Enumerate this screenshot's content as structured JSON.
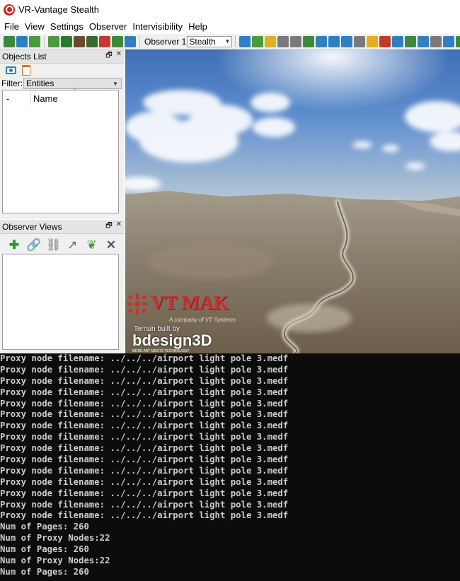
{
  "window": {
    "title": "VR-Vantage Stealth"
  },
  "menu": [
    "File",
    "View",
    "Settings",
    "Observer",
    "Intervisibility",
    "Help"
  ],
  "toolbar": {
    "observer_label": "Observer 1",
    "observer_mode": "Stealth",
    "icon_colors": [
      "#3a8a3a",
      "#2f7fc1",
      "#4b9a3b",
      "#6b4a2a",
      "#c23a2e",
      "#e0b020",
      "#7a7a7a"
    ]
  },
  "objects_panel": {
    "title": "Objects List",
    "filter_label": "Filter:",
    "filter_value": "Entities",
    "columns": [
      "-",
      "Name"
    ],
    "rows": []
  },
  "views_panel": {
    "title": "Observer Views",
    "rows": []
  },
  "viewport": {
    "logo_name": "VT MAK",
    "logo_subtitle": "A company of VT Systems",
    "terrain_credit": "Terrain built by",
    "terrain_brand": "bdesign3D",
    "terrain_tagline": "MERE ART MEETS TECHNOLOGY"
  },
  "console": {
    "lines": [
      "Proxy node filename: ../../../airport light pole 3.medf",
      "Proxy node filename: ../../../airport light pole 3.medf",
      "Proxy node filename: ../../../airport light pole 3.medf",
      "Proxy node filename: ../../../airport light pole 3.medf",
      "Proxy node filename: ../../../airport light pole 3.medf",
      "Proxy node filename: ../../../airport light pole 3.medf",
      "Proxy node filename: ../../../airport light pole 3.medf",
      "Proxy node filename: ../../../airport light pole 3.medf",
      "Proxy node filename: ../../../airport light pole 3.medf",
      "Proxy node filename: ../../../airport light pole 3.medf",
      "Proxy node filename: ../../../airport light pole 3.medf",
      "Proxy node filename: ../../../airport light pole 3.medf",
      "Proxy node filename: ../../../airport light pole 3.medf",
      "Proxy node filename: ../../../airport light pole 3.medf",
      "Proxy node filename: ../../../airport light pole 3.medf",
      "Num of Pages: 260",
      "Num of Proxy Nodes:22",
      "Num of Pages: 260",
      "Num of Proxy Nodes:22",
      "Num of Pages: 260"
    ]
  }
}
